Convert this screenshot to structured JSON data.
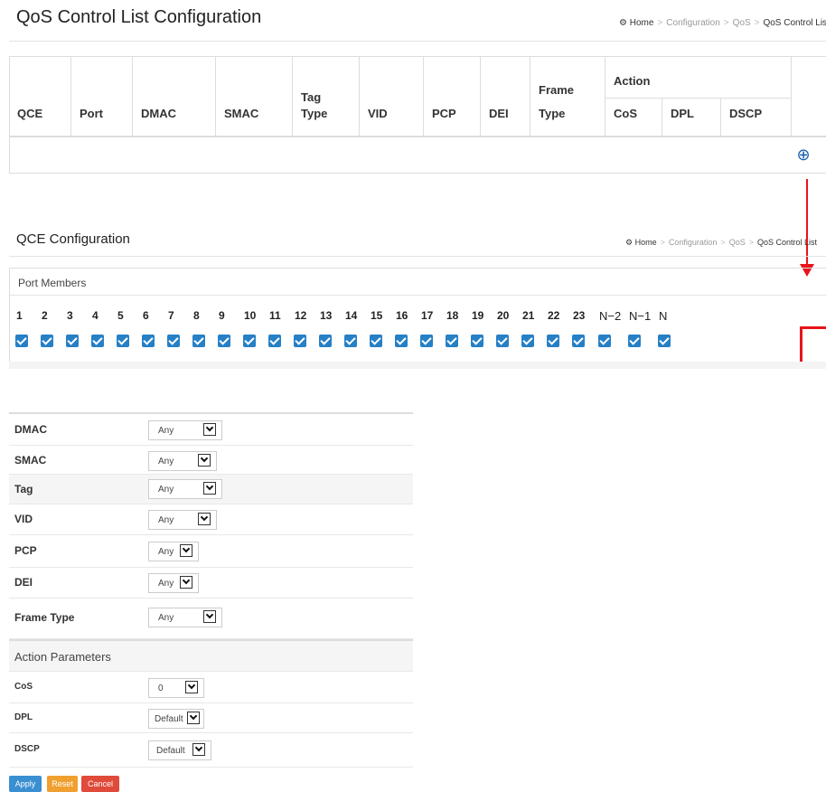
{
  "list": {
    "title": "QoS Control List Configuration",
    "breadcrumb": {
      "home": "Home",
      "sep": ">",
      "items": [
        "Configuration",
        "QoS"
      ],
      "current": "QoS Control Lis"
    },
    "headers": {
      "qce": "QCE",
      "port": "Port",
      "dmac": "DMAC",
      "smac": "SMAC",
      "tag_type_1": "Tag",
      "tag_type_2": "Type",
      "vid": "VID",
      "pcp": "PCP",
      "dei": "DEI",
      "frame_type_1": "Frame",
      "frame_type_2": "Type",
      "action": "Action",
      "cos": "CoS",
      "dpl": "DPL",
      "dscp": "DSCP"
    },
    "add_icon": "plus-circle-icon"
  },
  "config": {
    "title": "QCE Configuration",
    "breadcrumb": {
      "home": "Home",
      "sep": ">",
      "items": [
        "Configuration",
        "QoS"
      ],
      "current": "QoS Control List"
    },
    "port_members": {
      "label": "Port Members",
      "ports": [
        "1",
        "2",
        "3",
        "4",
        "5",
        "6",
        "7",
        "8",
        "9",
        "10",
        "11",
        "12",
        "13",
        "14",
        "15",
        "16",
        "17",
        "18",
        "19",
        "20",
        "21",
        "22",
        "23",
        "N−2",
        "N−1",
        "N"
      ],
      "checked": true
    }
  },
  "form": {
    "rows": [
      {
        "label": "DMAC",
        "value": "Any"
      },
      {
        "label": "SMAC",
        "value": "Any"
      },
      {
        "label": "Tag",
        "value": "Any"
      },
      {
        "label": "VID",
        "value": "Any"
      },
      {
        "label": "PCP",
        "value": "Any"
      },
      {
        "label": "DEI",
        "value": "Any"
      },
      {
        "label": "Frame Type",
        "value": "Any"
      }
    ],
    "action_header": "Action Parameters",
    "action_rows": [
      {
        "label": "CoS",
        "value": "0"
      },
      {
        "label": "DPL",
        "value": "Default"
      },
      {
        "label": "DSCP",
        "value": "Default"
      }
    ]
  },
  "buttons": {
    "apply": "Apply",
    "reset": "Reset",
    "cancel": "Cancel"
  },
  "colors": {
    "checkbox": "#2680c6",
    "highlight": "#e8141a",
    "apply": "#3a8fd0",
    "reset": "#f0a030",
    "cancel": "#e04a3a"
  }
}
